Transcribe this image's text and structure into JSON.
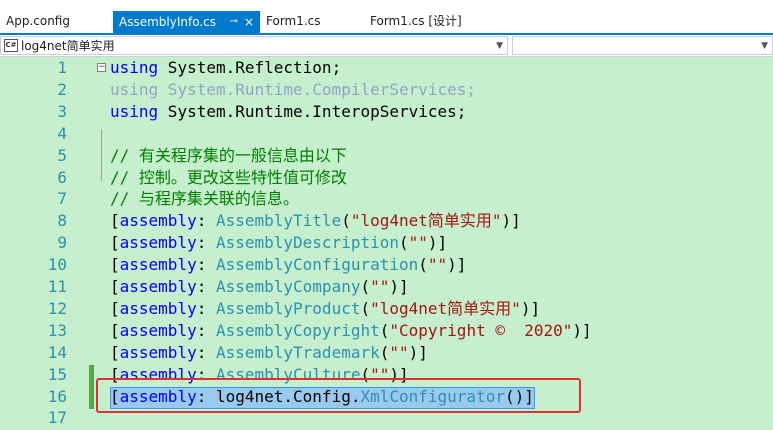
{
  "tabs": [
    {
      "label": "App.config",
      "active": false
    },
    {
      "label": "AssemblyInfo.cs",
      "active": true,
      "pin_icon": "pin-icon",
      "close_icon": "close-icon"
    },
    {
      "label": "Form1.cs",
      "active": false
    },
    {
      "label": "Form1.cs [设计]",
      "active": false
    }
  ],
  "navbar": {
    "project_icon": "csharp-project-icon",
    "project_label": "C#",
    "project": "log4net简单实用"
  },
  "editor": {
    "lines": [
      {
        "num": "1",
        "tokens": [
          {
            "t": "using",
            "c": "kw"
          },
          {
            "t": " System.Reflection;",
            "c": "plain"
          }
        ]
      },
      {
        "num": "2",
        "tokens": [
          {
            "t": "using System.Runtime.CompilerServices;",
            "c": "dim"
          }
        ]
      },
      {
        "num": "3",
        "tokens": [
          {
            "t": "using",
            "c": "kw"
          },
          {
            "t": " System.Runtime.InteropServices;",
            "c": "plain"
          }
        ]
      },
      {
        "num": "4",
        "tokens": []
      },
      {
        "num": "5",
        "tokens": [
          {
            "t": "// 有关程序集的一般信息由以下",
            "c": "cm"
          }
        ]
      },
      {
        "num": "6",
        "tokens": [
          {
            "t": "// 控制。更改这些特性值可修改",
            "c": "cm"
          }
        ]
      },
      {
        "num": "7",
        "tokens": [
          {
            "t": "// 与程序集关联的信息。",
            "c": "cm"
          }
        ]
      },
      {
        "num": "8",
        "tokens": [
          {
            "t": "[",
            "c": "plain"
          },
          {
            "t": "assembly",
            "c": "kw"
          },
          {
            "t": ": ",
            "c": "plain"
          },
          {
            "t": "AssemblyTitle",
            "c": "typ"
          },
          {
            "t": "(",
            "c": "plain"
          },
          {
            "t": "\"log4net简单实用\"",
            "c": "str"
          },
          {
            "t": ")]",
            "c": "plain"
          }
        ]
      },
      {
        "num": "9",
        "tokens": [
          {
            "t": "[",
            "c": "plain"
          },
          {
            "t": "assembly",
            "c": "kw"
          },
          {
            "t": ": ",
            "c": "plain"
          },
          {
            "t": "AssemblyDescription",
            "c": "typ"
          },
          {
            "t": "(",
            "c": "plain"
          },
          {
            "t": "\"\"",
            "c": "str"
          },
          {
            "t": ")]",
            "c": "plain"
          }
        ]
      },
      {
        "num": "10",
        "tokens": [
          {
            "t": "[",
            "c": "plain"
          },
          {
            "t": "assembly",
            "c": "kw"
          },
          {
            "t": ": ",
            "c": "plain"
          },
          {
            "t": "AssemblyConfiguration",
            "c": "typ"
          },
          {
            "t": "(",
            "c": "plain"
          },
          {
            "t": "\"\"",
            "c": "str"
          },
          {
            "t": ")]",
            "c": "plain"
          }
        ]
      },
      {
        "num": "11",
        "tokens": [
          {
            "t": "[",
            "c": "plain"
          },
          {
            "t": "assembly",
            "c": "kw"
          },
          {
            "t": ": ",
            "c": "plain"
          },
          {
            "t": "AssemblyCompany",
            "c": "typ"
          },
          {
            "t": "(",
            "c": "plain"
          },
          {
            "t": "\"\"",
            "c": "str"
          },
          {
            "t": ")]",
            "c": "plain"
          }
        ]
      },
      {
        "num": "12",
        "tokens": [
          {
            "t": "[",
            "c": "plain"
          },
          {
            "t": "assembly",
            "c": "kw"
          },
          {
            "t": ": ",
            "c": "plain"
          },
          {
            "t": "AssemblyProduct",
            "c": "typ"
          },
          {
            "t": "(",
            "c": "plain"
          },
          {
            "t": "\"log4net简单实用\"",
            "c": "str"
          },
          {
            "t": ")]",
            "c": "plain"
          }
        ]
      },
      {
        "num": "13",
        "tokens": [
          {
            "t": "[",
            "c": "plain"
          },
          {
            "t": "assembly",
            "c": "kw"
          },
          {
            "t": ": ",
            "c": "plain"
          },
          {
            "t": "AssemblyCopyright",
            "c": "typ"
          },
          {
            "t": "(",
            "c": "plain"
          },
          {
            "t": "\"Copyright ©  2020\"",
            "c": "str"
          },
          {
            "t": ")]",
            "c": "plain"
          }
        ]
      },
      {
        "num": "14",
        "tokens": [
          {
            "t": "[",
            "c": "plain"
          },
          {
            "t": "assembly",
            "c": "kw"
          },
          {
            "t": ": ",
            "c": "plain"
          },
          {
            "t": "AssemblyTrademark",
            "c": "typ"
          },
          {
            "t": "(",
            "c": "plain"
          },
          {
            "t": "\"\"",
            "c": "str"
          },
          {
            "t": ")]",
            "c": "plain"
          }
        ]
      },
      {
        "num": "15",
        "tokens": [
          {
            "t": "[",
            "c": "plain"
          },
          {
            "t": "assembly",
            "c": "kw"
          },
          {
            "t": ": ",
            "c": "plain"
          },
          {
            "t": "AssemblyCulture",
            "c": "typ"
          },
          {
            "t": "(",
            "c": "plain"
          },
          {
            "t": "\"\"",
            "c": "str"
          },
          {
            "t": ")]",
            "c": "plain"
          }
        ]
      },
      {
        "num": "16",
        "tokens": [
          {
            "t": "[",
            "c": "plain"
          },
          {
            "t": "assembly",
            "c": "kw"
          },
          {
            "t": ": log4net.Config.",
            "c": "plain"
          },
          {
            "t": "XmlConfigurator",
            "c": "typ"
          },
          {
            "t": "()]",
            "c": "plain"
          }
        ]
      },
      {
        "num": "17",
        "tokens": []
      }
    ],
    "selected_line": "16"
  },
  "colors": {
    "editor_bg": "#c6efce",
    "keyword": "#0000ff",
    "comment": "#008000",
    "string": "#a31515",
    "type": "#2b91af",
    "tab_active": "#007acc",
    "highlight_box": "#e03030"
  }
}
